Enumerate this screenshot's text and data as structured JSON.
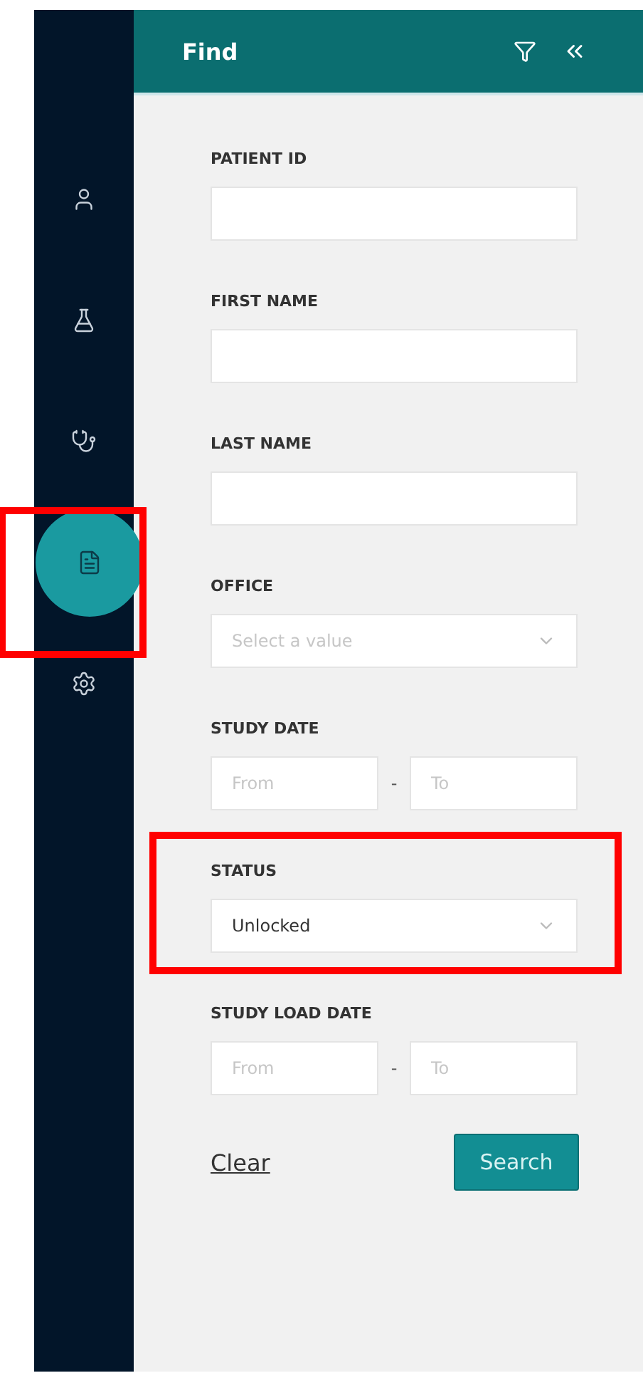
{
  "sidebar": {
    "items": [
      {
        "selected": false,
        "highlighted": false
      },
      {
        "selected": false,
        "highlighted": false
      },
      {
        "selected": false,
        "highlighted": false
      },
      {
        "selected": true,
        "highlighted": true
      },
      {
        "selected": false,
        "highlighted": false
      }
    ]
  },
  "panel": {
    "title": "Find"
  },
  "fields": [
    {
      "kind": "text",
      "label": "PATIENT ID",
      "highlighted": false
    },
    {
      "kind": "text",
      "label": "FIRST NAME",
      "highlighted": false
    },
    {
      "kind": "text",
      "label": "LAST NAME",
      "highlighted": false
    },
    {
      "kind": "select",
      "label": "OFFICE",
      "placeholder": "Select a value",
      "highlighted": false
    },
    {
      "kind": "daterange",
      "label": "STUDY DATE",
      "from_placeholder": "From",
      "separator": "-",
      "to_placeholder": "To",
      "highlighted": false
    },
    {
      "kind": "select",
      "label": "STATUS",
      "value": "Unlocked",
      "highlighted": true
    },
    {
      "kind": "daterange",
      "label": "STUDY LOAD DATE",
      "from_placeholder": "From",
      "separator": "-",
      "to_placeholder": "To",
      "highlighted": false
    }
  ],
  "actions": {
    "clear": "Clear",
    "search": "Search"
  }
}
